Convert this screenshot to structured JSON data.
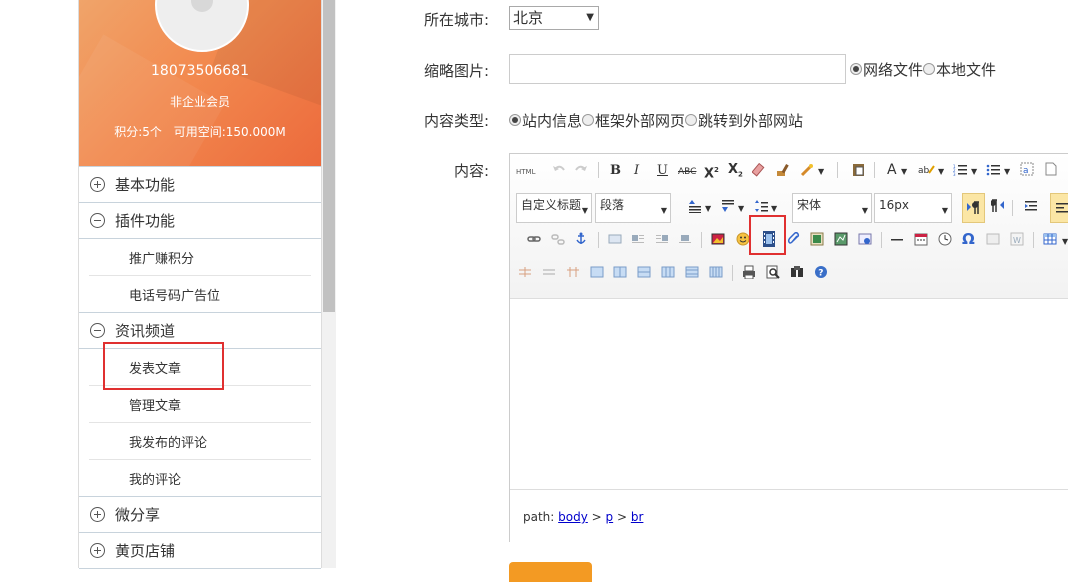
{
  "profile": {
    "phone": "18073506681",
    "level": "非企业会员",
    "points": "积分:5个",
    "space": "可用空间:150.000M"
  },
  "menu": {
    "basic": "基本功能",
    "plugin": "插件功能",
    "plugin_items": [
      "推广赚积分",
      "电话号码广告位"
    ],
    "news": "资讯频道",
    "news_items": [
      "发表文章",
      "管理文章",
      "我发布的评论",
      "我的评论"
    ],
    "weishare": "微分享",
    "yellowpage": "黄页店铺"
  },
  "form": {
    "city_label": "所在城市:",
    "city_value": "北京",
    "thumb_label": "缩略图片:",
    "thumb_opts": [
      "网络文件",
      "本地文件"
    ],
    "type_label": "内容类型:",
    "type_opts": [
      "站内信息",
      "框架外部网页",
      "跳转到外部网站"
    ],
    "content_label": "内容:"
  },
  "editor": {
    "heading_select": "自定义标题",
    "paragraph_select": "段落",
    "font_select": "宋体",
    "size_select": "16px",
    "path_label": "path:",
    "path": [
      "body",
      "p",
      "br"
    ]
  },
  "colors": {
    "highlight": "#e03030",
    "accent": "#f39a23",
    "profile": "#f28a4f"
  }
}
